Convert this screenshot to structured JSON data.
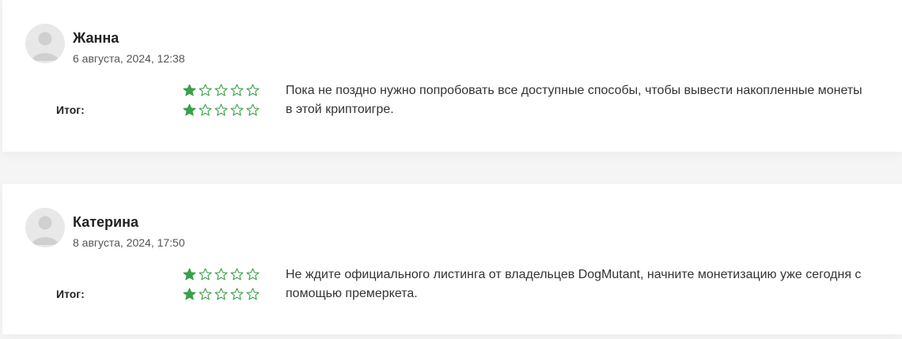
{
  "accent_color": "#3aa04b",
  "reviews": [
    {
      "name": "Жанна",
      "date": "6 августа, 2024, 12:38",
      "comment": "Пока не поздно нужно попробовать все доступные способы, чтобы вывести накопленные монеты в этой криптоигре.",
      "total_label": "Итог:",
      "ratings": [
        {
          "value": 1,
          "max": 5
        },
        {
          "value": 1,
          "max": 5
        }
      ]
    },
    {
      "name": "Катерина",
      "date": "8 августа, 2024, 17:50",
      "comment": "Не ждите официального листинга от владельцев DogMutant, начните монетизацию уже сегодня с помощью премеркета.",
      "total_label": "Итог:",
      "ratings": [
        {
          "value": 1,
          "max": 5
        },
        {
          "value": 1,
          "max": 5
        }
      ]
    }
  ]
}
